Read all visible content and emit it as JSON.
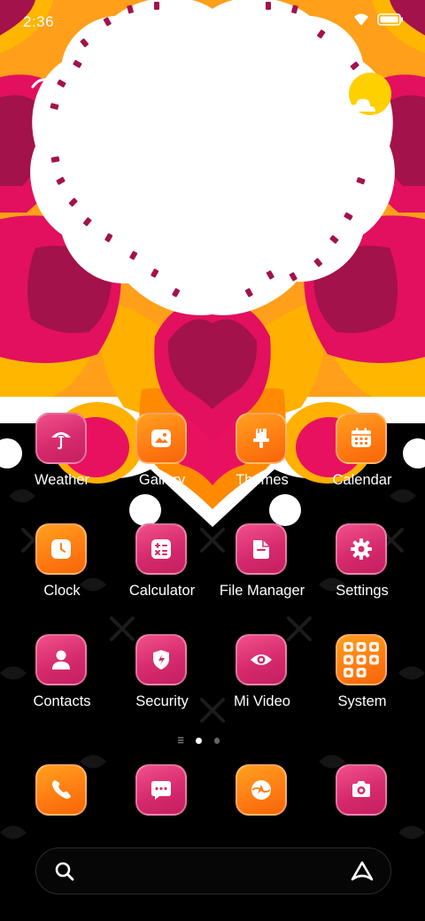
{
  "status": {
    "time": "2:36"
  },
  "icons": {
    "wifi": "wifi-icon",
    "battery": "battery-icon",
    "weather_widget": "umbrella-icon",
    "sun": "sun-icon"
  },
  "apps": [
    {
      "label": "Weather",
      "icon": "umbrella-icon",
      "style": "pink"
    },
    {
      "label": "Gallery",
      "icon": "gallery-icon",
      "style": "orange"
    },
    {
      "label": "Themes",
      "icon": "paintbrush-icon",
      "style": "orange"
    },
    {
      "label": "Calendar",
      "icon": "calendar-icon",
      "style": "orange"
    },
    {
      "label": "Clock",
      "icon": "clock-icon",
      "style": "orange"
    },
    {
      "label": "Calculator",
      "icon": "calculator-icon",
      "style": "pink"
    },
    {
      "label": "File Manager",
      "icon": "folder-icon",
      "style": "pink"
    },
    {
      "label": "Settings",
      "icon": "gear-icon",
      "style": "pink"
    },
    {
      "label": "Contacts",
      "icon": "person-icon",
      "style": "pink"
    },
    {
      "label": "Security",
      "icon": "shield-icon",
      "style": "pink"
    },
    {
      "label": "Mi Video",
      "icon": "eye-icon",
      "style": "pink"
    },
    {
      "label": "System",
      "icon": "folder-grid-icon",
      "style": "orange"
    }
  ],
  "dock": [
    {
      "name": "phone",
      "icon": "phone-icon",
      "style": "orange"
    },
    {
      "name": "messages",
      "icon": "message-icon",
      "style": "pink"
    },
    {
      "name": "browser",
      "icon": "browser-icon",
      "style": "orange"
    },
    {
      "name": "camera",
      "icon": "camera-icon",
      "style": "pink"
    }
  ],
  "page_indicator": {
    "pages": 2,
    "current": 1
  },
  "search": {
    "icon": "search-icon",
    "assistant_icon": "assistant-icon"
  },
  "colors": {
    "pink": "#d62a6d",
    "orange": "#ff7a12",
    "magenta": "#e0115f",
    "yellow": "#ffc400",
    "wine": "#a0124a"
  }
}
